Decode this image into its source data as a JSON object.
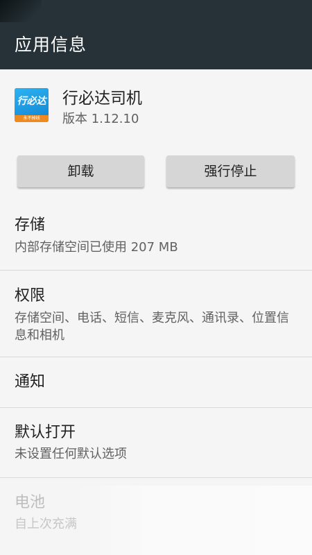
{
  "appbar": {
    "title": "应用信息"
  },
  "app": {
    "icon_text": "行必达",
    "icon_sub": "永不掉线",
    "name": "行必达司机",
    "version": "版本 1.12.10"
  },
  "buttons": {
    "uninstall": "卸载",
    "force_stop": "强行停止"
  },
  "storage": {
    "title": "存储",
    "summary": "内部存储空间已使用 207 MB"
  },
  "permissions": {
    "title": "权限",
    "summary": "存储空间、电话、短信、麦克风、通讯录、位置信息和相机"
  },
  "notifications": {
    "title": "通知"
  },
  "open_by_default": {
    "title": "默认打开",
    "summary": "未设置任何默认选项"
  },
  "battery": {
    "title": "电池",
    "summary": "自上次充满"
  },
  "colors": {
    "appbar": "#263238",
    "background": "#f5f5f5",
    "button": "#d6d6d6",
    "icon_blue": "#1a9be6",
    "icon_orange": "#f08a1e"
  }
}
